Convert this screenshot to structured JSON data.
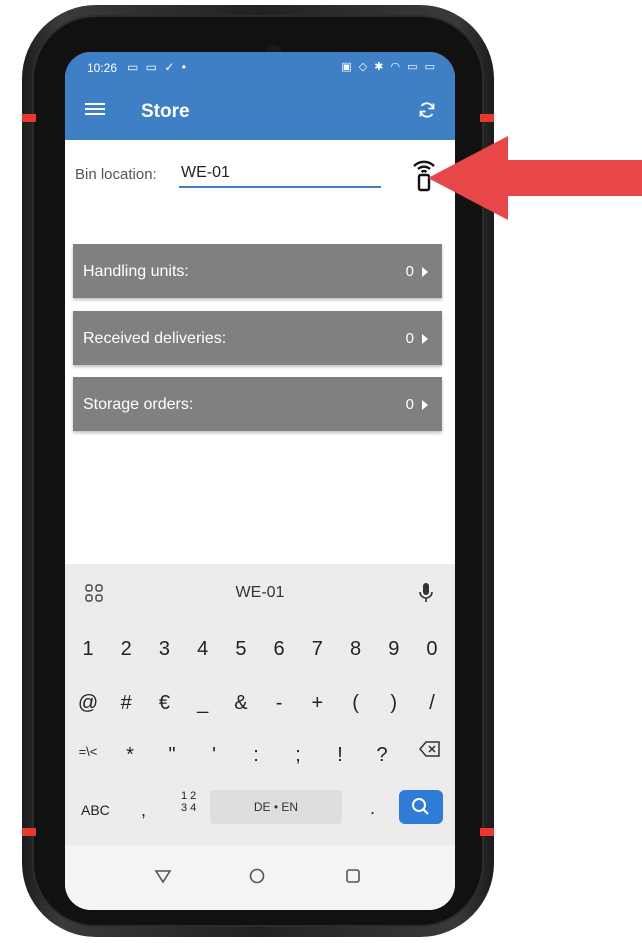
{
  "status_bar": {
    "time": "10:26",
    "left_icons": "▭ ▭ ✓ •",
    "right_icons": "▣ ◇ ✱ ◠ ▭ ▭"
  },
  "app_bar": {
    "title": "Store",
    "menu_icon": "hamburger-icon",
    "refresh_icon": "refresh-icon"
  },
  "bin": {
    "label": "Bin location:",
    "value": "WE-01",
    "scan_icon": "rfid-scanner-icon"
  },
  "list": [
    {
      "label": "Handling units:",
      "count": "0"
    },
    {
      "label": "Received deliveries:",
      "count": "0"
    },
    {
      "label": "Storage orders:",
      "count": "0"
    }
  ],
  "keyboard": {
    "suggestion": "WE-01",
    "row1": [
      "1",
      "2",
      "3",
      "4",
      "5",
      "6",
      "7",
      "8",
      "9",
      "0"
    ],
    "row2": [
      "@",
      "#",
      "€",
      "_",
      "&",
      "-",
      "+",
      "(",
      ")",
      "/"
    ],
    "row3": [
      "=\\<",
      "*",
      "\"",
      "'",
      ":",
      ";",
      "!",
      "?"
    ],
    "abc": "ABC",
    "comma": ",",
    "fraction_top": "1 2",
    "fraction_bottom": "3 4",
    "space": "DE • EN",
    "dot": "."
  },
  "colors": {
    "primary": "#3f7fc6",
    "list_bg": "#808080",
    "arrow": "#e8474a"
  }
}
